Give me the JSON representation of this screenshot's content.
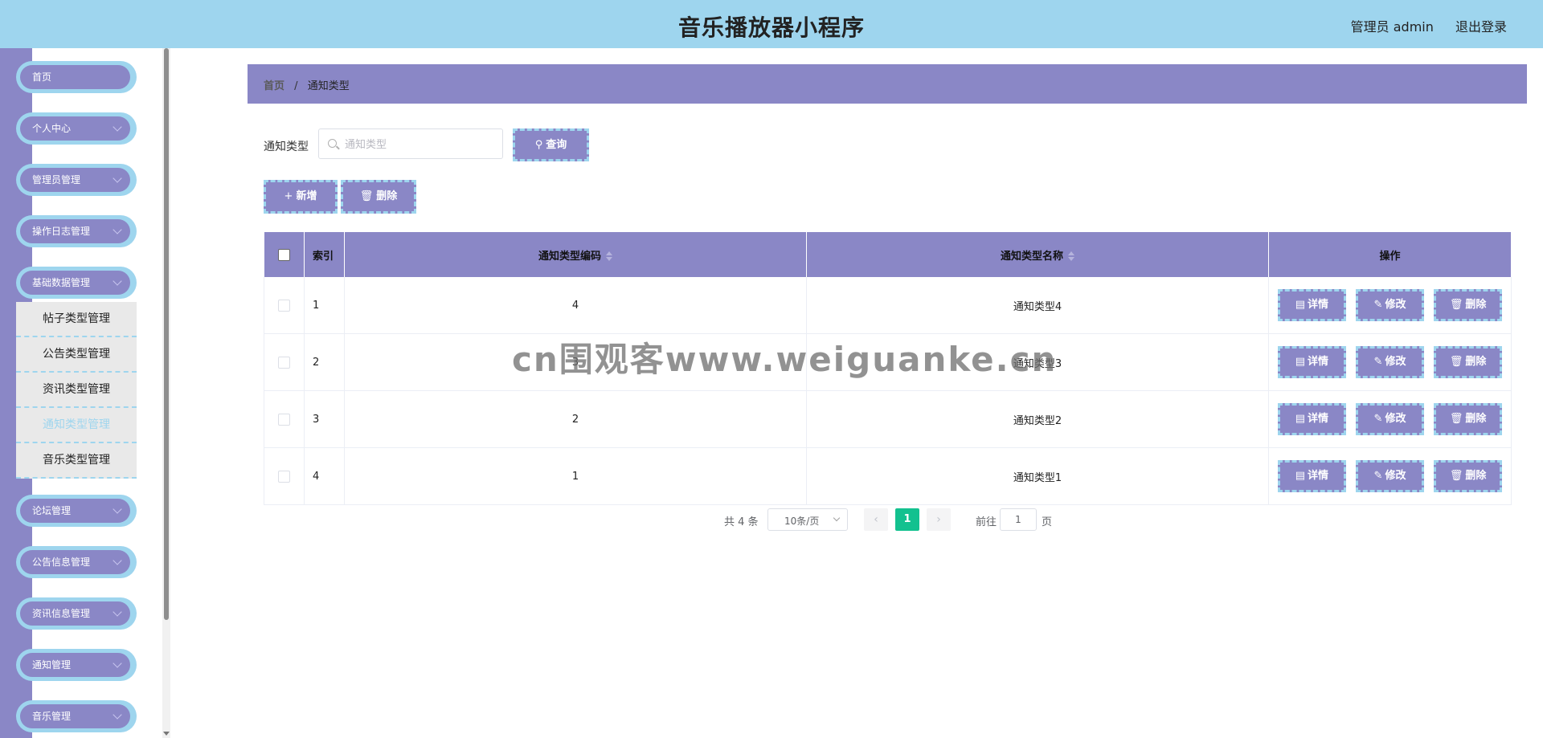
{
  "header": {
    "title": "音乐播放器小程序",
    "user_label": "管理员 admin",
    "logout_label": "退出登录"
  },
  "sidebar": {
    "menu": [
      {
        "label": "首页",
        "has_children": false
      },
      {
        "label": "个人中心",
        "has_children": true
      },
      {
        "label": "管理员管理",
        "has_children": true
      },
      {
        "label": "操作日志管理",
        "has_children": true
      },
      {
        "label": "基础数据管理",
        "has_children": true,
        "expanded": true
      },
      {
        "label": "论坛管理",
        "has_children": true
      },
      {
        "label": "公告信息管理",
        "has_children": true
      },
      {
        "label": "资讯信息管理",
        "has_children": true
      },
      {
        "label": "通知管理",
        "has_children": true
      },
      {
        "label": "音乐管理",
        "has_children": true
      }
    ],
    "submenu": [
      {
        "label": "帖子类型管理",
        "active": false
      },
      {
        "label": "公告类型管理",
        "active": false
      },
      {
        "label": "资讯类型管理",
        "active": false
      },
      {
        "label": "通知类型管理",
        "active": true
      },
      {
        "label": "音乐类型管理",
        "active": false
      }
    ]
  },
  "breadcrumb": {
    "home": "首页",
    "separator": "/",
    "current": "通知类型"
  },
  "search": {
    "label": "通知类型",
    "placeholder": "通知类型",
    "value": "",
    "query_button": "查询"
  },
  "actions": {
    "add_label": "新增",
    "delete_label": "删除"
  },
  "table": {
    "headers": {
      "index": "索引",
      "code": "通知类型编码",
      "name": "通知类型名称",
      "ops": "操作"
    },
    "rows": [
      {
        "index": "1",
        "code": "4",
        "name": "通知类型4"
      },
      {
        "index": "2",
        "code": "3",
        "name": "通知类型3"
      },
      {
        "index": "3",
        "code": "2",
        "name": "通知类型2"
      },
      {
        "index": "4",
        "code": "1",
        "name": "通知类型1"
      }
    ],
    "op_labels": {
      "detail": "详情",
      "edit": "修改",
      "delete": "删除"
    }
  },
  "pagination": {
    "total_text": "共 4 条",
    "page_size": "10条/页",
    "current_page": "1",
    "goto_label": "前往",
    "goto_value": "1",
    "unit": "页"
  },
  "watermark": "cn围观客www.weiguanke.cn",
  "colors": {
    "header_bg": "#9ed5ee",
    "accent_purple": "#8a87c6",
    "dashed_border": "#9ed5ee",
    "page_active": "#13c18f"
  }
}
